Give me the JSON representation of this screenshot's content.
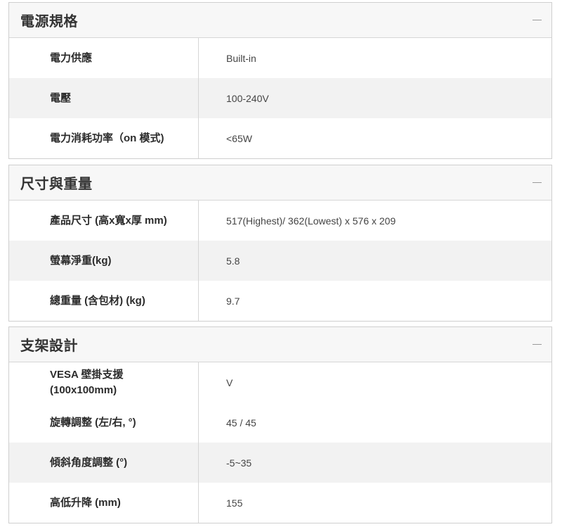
{
  "sections": [
    {
      "title": "電源規格",
      "collapse_symbol": "—",
      "rows": [
        {
          "label": "電力供應",
          "value": "Built-in"
        },
        {
          "label": "電壓",
          "value": "100-240V"
        },
        {
          "label": "電力消耗功率（on 模式)",
          "value": "<65W"
        }
      ]
    },
    {
      "title": "尺寸與重量",
      "collapse_symbol": "—",
      "rows": [
        {
          "label": "產品尺寸 (高x寬x厚 mm)",
          "value": "517(Highest)/ 362(Lowest) x 576 x 209"
        },
        {
          "label": "螢幕淨重(kg)",
          "value": "5.8"
        },
        {
          "label": "總重量 (含包材) (kg)",
          "value": "9.7"
        }
      ]
    },
    {
      "title": "支架設計",
      "collapse_symbol": "—",
      "rows": [
        {
          "label_line1": "VESA 壁掛支援",
          "label_line2": "(100x100mm)",
          "value": "V"
        },
        {
          "label": "旋轉調整 (左/右, °)",
          "value": "45 / 45"
        },
        {
          "label": "傾斜角度調整 (°)",
          "value": "-5~35"
        },
        {
          "label": "高低升降 (mm)",
          "value": "155"
        }
      ]
    }
  ]
}
